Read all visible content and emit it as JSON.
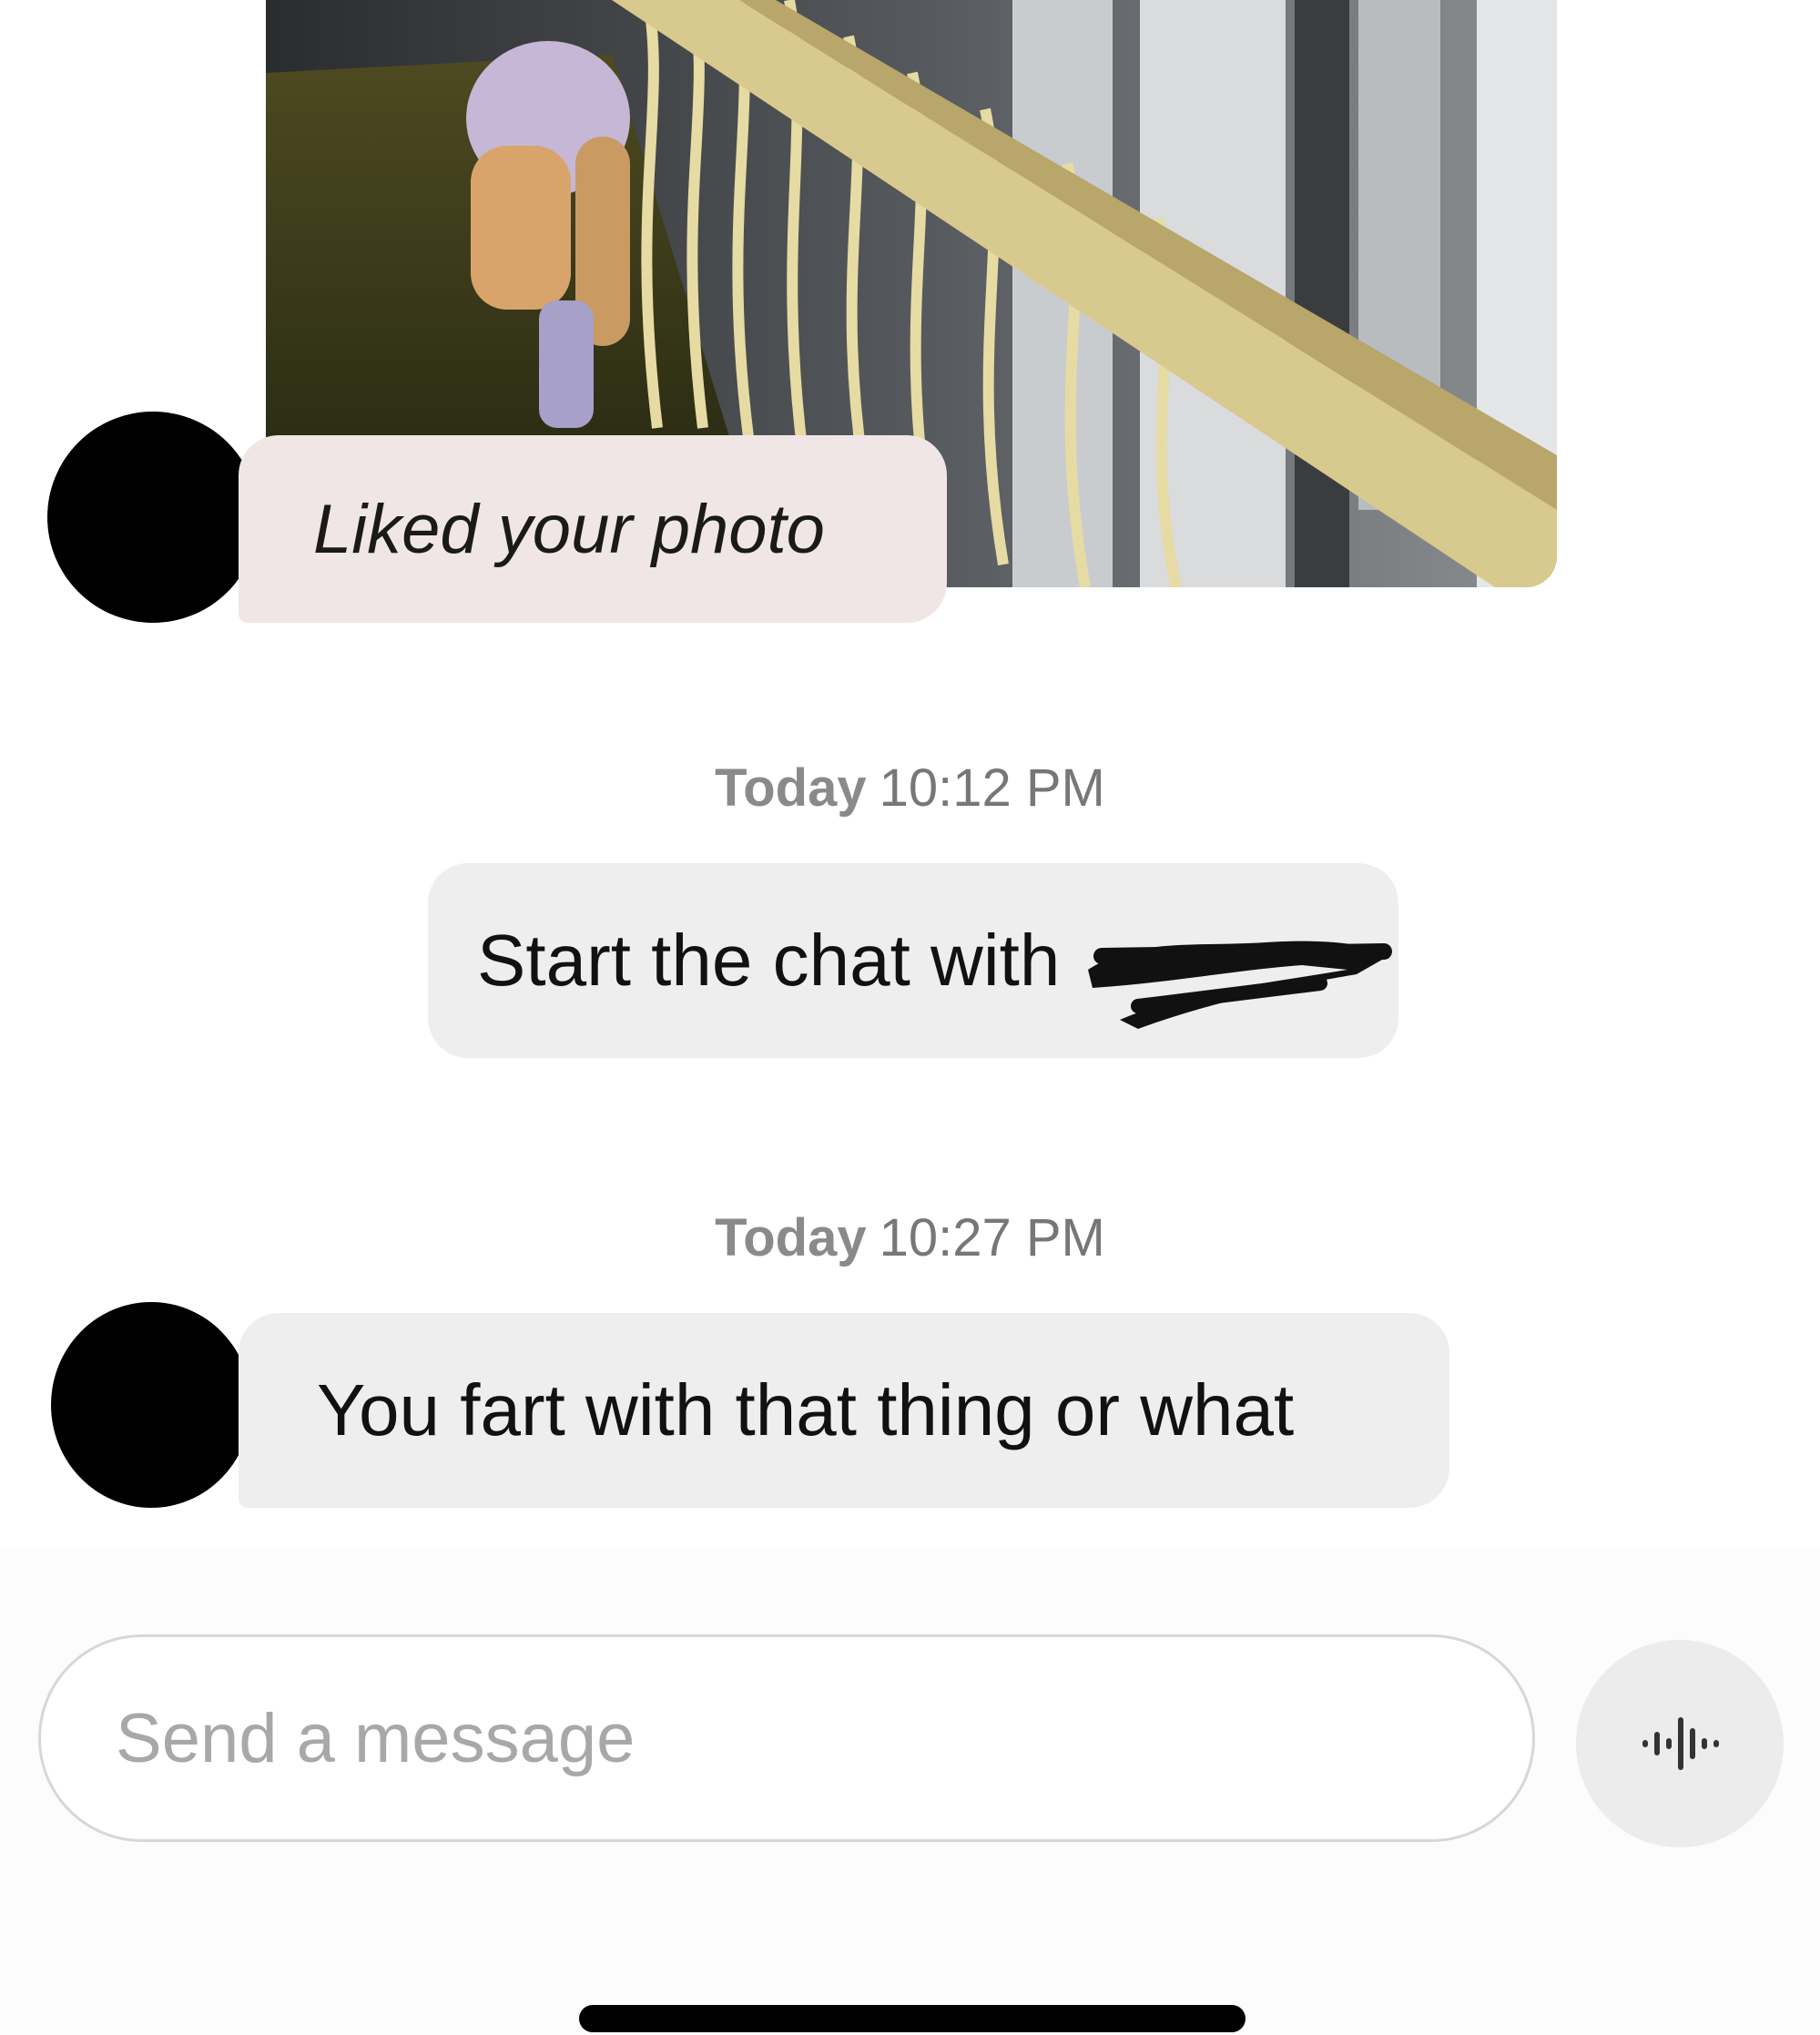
{
  "photo_message": {
    "reaction_text": "Liked your photo"
  },
  "timestamps": [
    {
      "day": "Today",
      "time": "10:12 PM"
    },
    {
      "day": "Today",
      "time": "10:27 PM"
    }
  ],
  "system_message": {
    "text": "Start the chat with"
  },
  "incoming_message": {
    "text": "You fart with that thing or what"
  },
  "composer": {
    "placeholder": "Send a message",
    "voice_icon": "voice-waveform-icon"
  },
  "colors": {
    "liked_bubble_bg": "#f0e6e6",
    "bubble_bg": "#eeeeee",
    "timestamp_text": "#777777"
  }
}
